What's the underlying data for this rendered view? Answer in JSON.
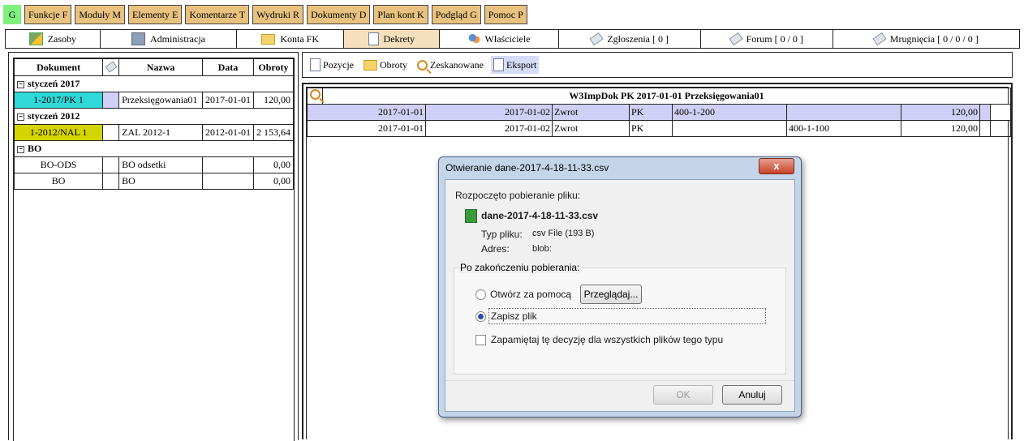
{
  "topbar": {
    "home": "G",
    "items": [
      "Funkcje F",
      "Moduły M",
      "Elementy E",
      "Komentarze T",
      "Wydruki R",
      "Dokumenty D",
      "Plan kont K",
      "Podgląd G",
      "Pomoc P"
    ]
  },
  "tabs": [
    {
      "label": "Zasoby",
      "icon": "chart-icon"
    },
    {
      "label": "Administracja",
      "icon": "admin-icon"
    },
    {
      "label": "Konta FK",
      "icon": "folder-icon"
    },
    {
      "label": "Dekrety",
      "icon": "document-icon",
      "active": true
    },
    {
      "label": "Właściciele",
      "icon": "people-icon"
    },
    {
      "label": "Zgłoszenia [ 0 ]",
      "icon": "tag-icon"
    },
    {
      "label": "Forum [ 0 / 0 ]",
      "icon": "tag-icon"
    },
    {
      "label": "Mrugnięcia [ 0 / 0 / 0 ]",
      "icon": "tag-icon"
    }
  ],
  "doc_table": {
    "headers": {
      "dokument": "Dokument",
      "nazwa": "Nazwa",
      "data": "Data",
      "obroty": "Obroty"
    },
    "groups": [
      {
        "label": "styczeń 2017",
        "rows": [
          {
            "dokument": "1-2017/PK 1",
            "nazwa": "Przeksięgowania01",
            "data": "2017-01-01",
            "obroty": "120,00"
          }
        ]
      },
      {
        "label": "styczeń 2012",
        "rows": [
          {
            "dokument": "1-2012/NAL 1",
            "nazwa": "ZAL 2012-1",
            "data": "2012-01-01",
            "obroty": "2 153,64"
          }
        ]
      },
      {
        "label": "BO",
        "rows": [
          {
            "dokument": "BO-ODS",
            "nazwa": "BO odsetki",
            "data": "",
            "obroty": "0,00"
          },
          {
            "dokument": "BO",
            "nazwa": "BO",
            "data": "",
            "obroty": "0,00"
          }
        ]
      }
    ]
  },
  "subtabs": [
    {
      "label": "Pozycje",
      "icon": "document-icon"
    },
    {
      "label": "Obroty",
      "icon": "folder-icon"
    },
    {
      "label": "Zeskanowane",
      "icon": "magnifier-icon"
    },
    {
      "label": "Eksport",
      "icon": "document-icon",
      "active": true
    }
  ],
  "grid": {
    "title": "W3ImpDok PK 2017-01-01 Przeksięgowania01",
    "rows": [
      {
        "d1": "2017-01-01",
        "d2": "2017-01-02",
        "opis": "Zwrot",
        "typ": "PK",
        "wn": "400-1-200",
        "ma": "",
        "kwota": "120,00"
      },
      {
        "d1": "2017-01-01",
        "d2": "2017-01-02",
        "opis": "Zwrot",
        "typ": "PK",
        "wn": "",
        "ma": "400-1-100",
        "kwota": "120,00"
      }
    ]
  },
  "dialog": {
    "title": "Otwieranie dane-2017-4-18-11-33.csv",
    "close": "x",
    "intro": "Rozpoczęto pobieranie pliku:",
    "filename": "dane-2017-4-18-11-33.csv",
    "type_label": "Typ pliku:",
    "type_value": "csv File (193 B)",
    "addr_label": "Adres:",
    "addr_value": "blob:",
    "section": "Po zakończeniu pobierania:",
    "open_with": "Otwórz za pomocą",
    "browse": "Przeglądaj...",
    "save": "Zapisz plik",
    "remember": "Zapamiętaj tę decyzję dla wszystkich plików tego typu",
    "ok": "OK",
    "cancel": "Anuluj"
  }
}
